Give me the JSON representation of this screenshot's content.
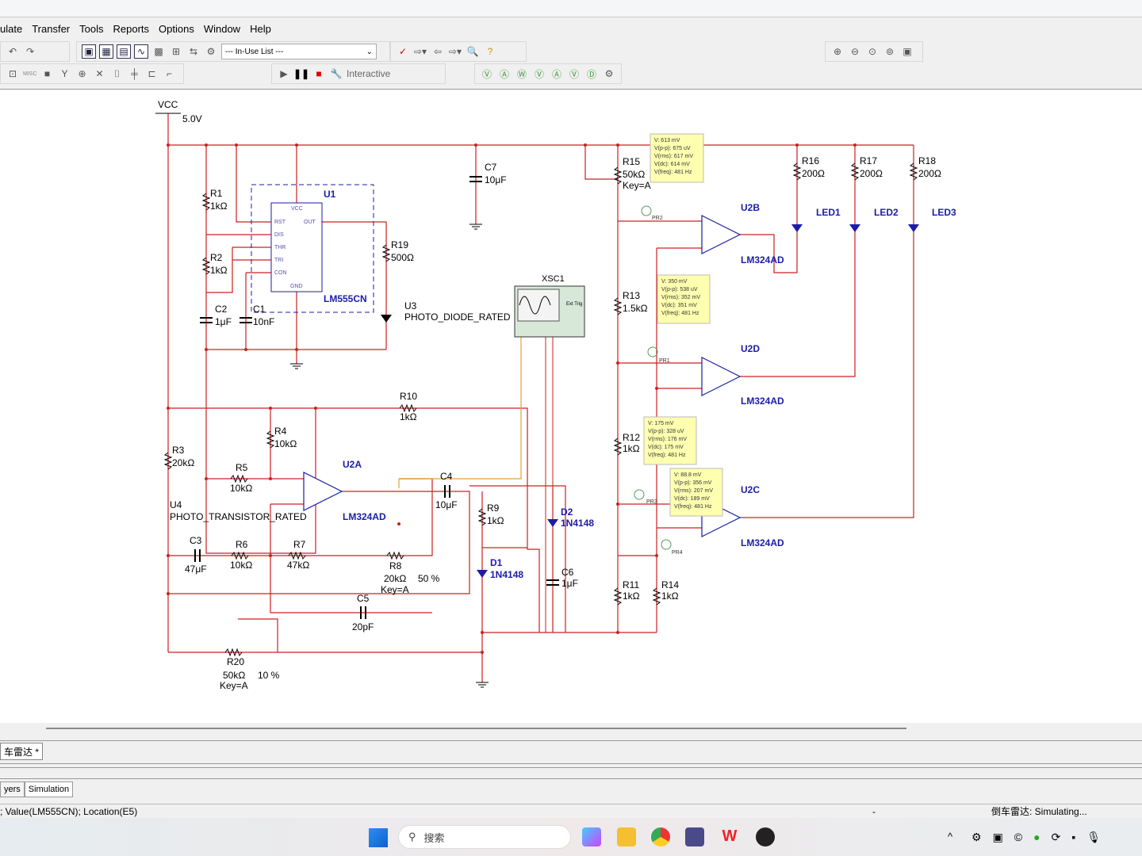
{
  "menu": [
    "ulate",
    "Transfer",
    "Tools",
    "Reports",
    "Options",
    "Window",
    "Help"
  ],
  "toolbar": {
    "inuse_list": "--- In-Use List ---",
    "interactive": "Interactive",
    "misc": "MISC"
  },
  "colors": {
    "wire": "#cc2020",
    "component": "#1c1ca8",
    "probe_bg": "#ffffb0",
    "scope_wire": "#e0a040"
  },
  "schematic": {
    "vcc": "VCC",
    "vcc_value": "5.0V",
    "R1": [
      "R1",
      "1kΩ"
    ],
    "R2": [
      "R2",
      "1kΩ"
    ],
    "C2": [
      "C2",
      "1μF"
    ],
    "C1": [
      "C1",
      "10nF"
    ],
    "U1": [
      "U1",
      "LM555CN"
    ],
    "u1_pins": [
      "VCC",
      "RST",
      "OUT",
      "DIS",
      "THR",
      "TRI",
      "CON",
      "GND"
    ],
    "R19": [
      "R19",
      "500Ω"
    ],
    "U3": [
      "U3",
      "PHOTO_DIODE_RATED"
    ],
    "C7": [
      "C7",
      "10μF"
    ],
    "XSC1": "XSC1",
    "scope_trig": "Ext Trig",
    "R10": [
      "R10",
      "1kΩ"
    ],
    "R4": [
      "R4",
      "10kΩ"
    ],
    "R3": [
      "R3",
      "20kΩ"
    ],
    "R5": [
      "R5",
      "10kΩ"
    ],
    "U2A": [
      "U2A",
      "LM324AD"
    ],
    "U4": [
      "U4",
      "PHOTO_TRANSISTOR_RATED"
    ],
    "C3": [
      "C3",
      "47μF"
    ],
    "R6": [
      "R6",
      "10kΩ"
    ],
    "R7": [
      "R7",
      "47kΩ"
    ],
    "R8": [
      "R8",
      "20kΩ",
      "50 %",
      "Key=A"
    ],
    "C4": [
      "C4",
      "10μF"
    ],
    "C5": [
      "C5",
      "20pF"
    ],
    "R9": [
      "R9",
      "1kΩ"
    ],
    "D1": [
      "D1",
      "1N4148"
    ],
    "D2": [
      "D2",
      "1N4148"
    ],
    "C6": [
      "C6",
      "1μF"
    ],
    "R20": [
      "R20",
      "50kΩ",
      "10 %",
      "Key=A"
    ],
    "R15": [
      "R15",
      "50kΩ",
      "Key=A"
    ],
    "R13": [
      "R13",
      "1.5kΩ"
    ],
    "R12": [
      "R12",
      "1kΩ"
    ],
    "R11": [
      "R11",
      "1kΩ"
    ],
    "R14": [
      "R14",
      "1kΩ"
    ],
    "U2B": [
      "U2B",
      "LM324AD"
    ],
    "U2D": [
      "U2D",
      "LM324AD"
    ],
    "U2C": [
      "U2C",
      "LM324AD"
    ],
    "R16": [
      "R16",
      "200Ω"
    ],
    "R17": [
      "R17",
      "200Ω"
    ],
    "R18": [
      "R18",
      "200Ω"
    ],
    "LED1": "LED1",
    "LED2": "LED2",
    "LED3": "LED3",
    "probes": [
      {
        "name": "PR2",
        "lines": [
          "V: 613 mV",
          "V(p-p): 675 uV",
          "V(rms): 617 mV",
          "V(dc): 614 mV",
          "V(freq): 481 Hz"
        ]
      },
      {
        "name": "PR1",
        "lines": [
          "V: 350 mV",
          "V(p-p): 538 uV",
          "V(rms): 352 mV",
          "V(dc): 351 mV",
          "V(freq): 481 Hz"
        ]
      },
      {
        "name": "PR3",
        "lines": [
          "V: 175 mV",
          "V(p-p): 328 uV",
          "V(rms): 176 mV",
          "V(dc): 175 mV",
          "V(freq): 481 Hz"
        ]
      },
      {
        "name": "PR4",
        "lines": [
          "V: 88.8 mV",
          "V(p-p): 356 mV",
          "V(rms): 207 mV",
          "V(dc): 189 mV",
          "V(freq): 481 Hz"
        ]
      }
    ]
  },
  "doc_tab": "车雷达 *",
  "panel_tabs": [
    "yers",
    "Simulation"
  ],
  "status": {
    "left": "; Value(LM555CN); Location(E5)",
    "mid": "-",
    "right": "倒车雷达: Simulating..."
  },
  "taskbar": {
    "search": "搜索"
  }
}
